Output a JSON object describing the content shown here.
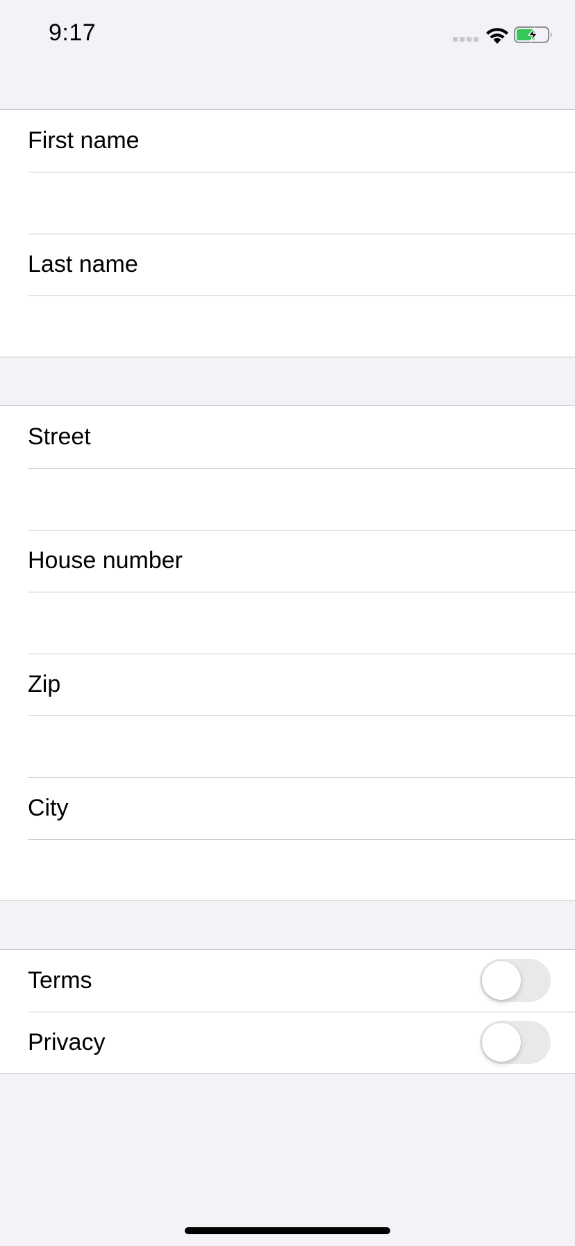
{
  "status_bar": {
    "time": "9:17",
    "icons": [
      "signal-dots-icon",
      "wifi-icon",
      "battery-charging-icon"
    ],
    "battery_color": "#34c759"
  },
  "name_section": {
    "first_name_label": "First name",
    "first_name_value": "",
    "last_name_label": "Last name",
    "last_name_value": ""
  },
  "address_section": {
    "street_label": "Street",
    "street_value": "",
    "house_number_label": "House number",
    "house_number_value": "",
    "zip_label": "Zip",
    "zip_value": "",
    "city_label": "City",
    "city_value": ""
  },
  "consent_section": {
    "terms_label": "Terms",
    "terms_on": false,
    "privacy_label": "Privacy",
    "privacy_on": false
  },
  "colors": {
    "background": "#f2f2f7",
    "cell": "#ffffff",
    "separator": "#c8c7cc",
    "toggle_off": "#e9e9eb"
  }
}
